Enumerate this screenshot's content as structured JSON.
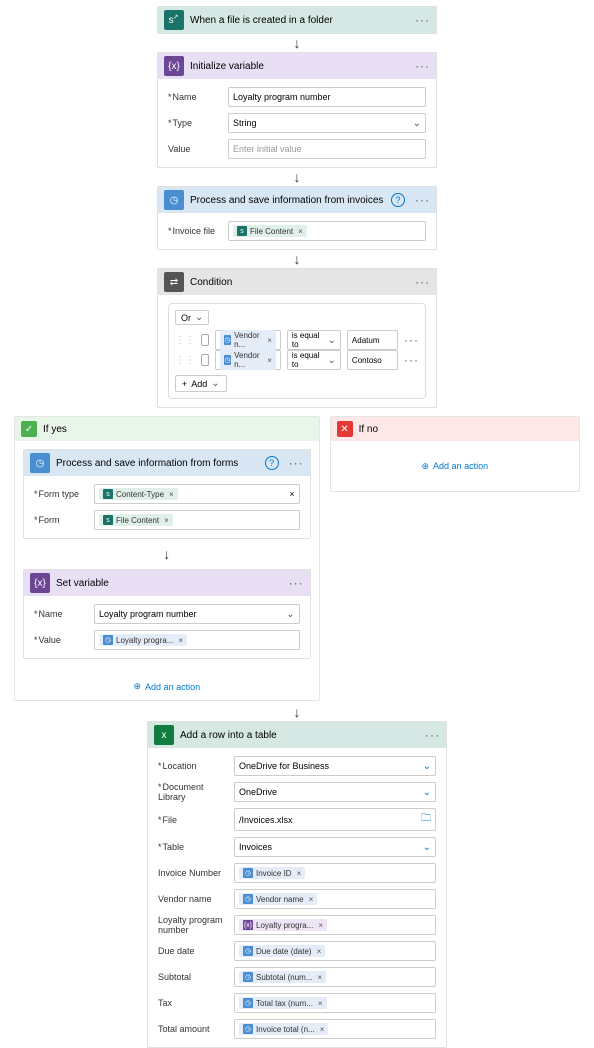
{
  "trigger": {
    "title": "When a file is created in a folder"
  },
  "init_var": {
    "title": "Initialize variable",
    "name_label": "Name",
    "name_value": "Loyalty program number",
    "type_label": "Type",
    "type_value": "String",
    "value_label": "Value",
    "value_placeholder": "Enter initial value"
  },
  "process_invoices": {
    "title": "Process and save information from invoices",
    "file_label": "Invoice file",
    "token": "File Content"
  },
  "condition": {
    "title": "Condition",
    "or_label": "Or",
    "rows": [
      {
        "left_token": "Vendor n...",
        "op": "is equal to",
        "right": "Adatum"
      },
      {
        "left_token": "Vendor n...",
        "op": "is equal to",
        "right": "Contoso"
      }
    ],
    "add_label": "Add"
  },
  "branches": {
    "yes_label": "If yes",
    "no_label": "If no",
    "add_action": "Add an action"
  },
  "process_forms": {
    "title": "Process and save information from  forms",
    "form_type_label": "Form type",
    "form_type_token": "Content-Type",
    "form_label": "Form",
    "form_token": "File Content"
  },
  "set_var": {
    "title": "Set variable",
    "name_label": "Name",
    "name_value": "Loyalty program number",
    "value_label": "Value",
    "value_token": "Loyalty progra..."
  },
  "excel": {
    "title": "Add a row into a table",
    "location_label": "Location",
    "location_value": "OneDrive for Business",
    "doclib_label": "Document Library",
    "doclib_value": "OneDrive",
    "file_label": "File",
    "file_value": "/Invoices.xlsx",
    "table_label": "Table",
    "table_value": "Invoices",
    "rows": [
      {
        "label": "Invoice Number",
        "token": "Invoice ID",
        "kind": "blue"
      },
      {
        "label": "Vendor name",
        "token": "Vendor name",
        "kind": "blue"
      },
      {
        "label": "Loyalty program number",
        "token": "Loyalty progra...",
        "kind": "purple"
      },
      {
        "label": "Due date",
        "token": "Due date (date)",
        "kind": "blue"
      },
      {
        "label": "Subtotal",
        "token": "Subtotal (num...",
        "kind": "blue"
      },
      {
        "label": "Tax",
        "token": "Total tax (num...",
        "kind": "blue"
      },
      {
        "label": "Total amount",
        "token": "Invoice total (n...",
        "kind": "blue"
      }
    ]
  }
}
